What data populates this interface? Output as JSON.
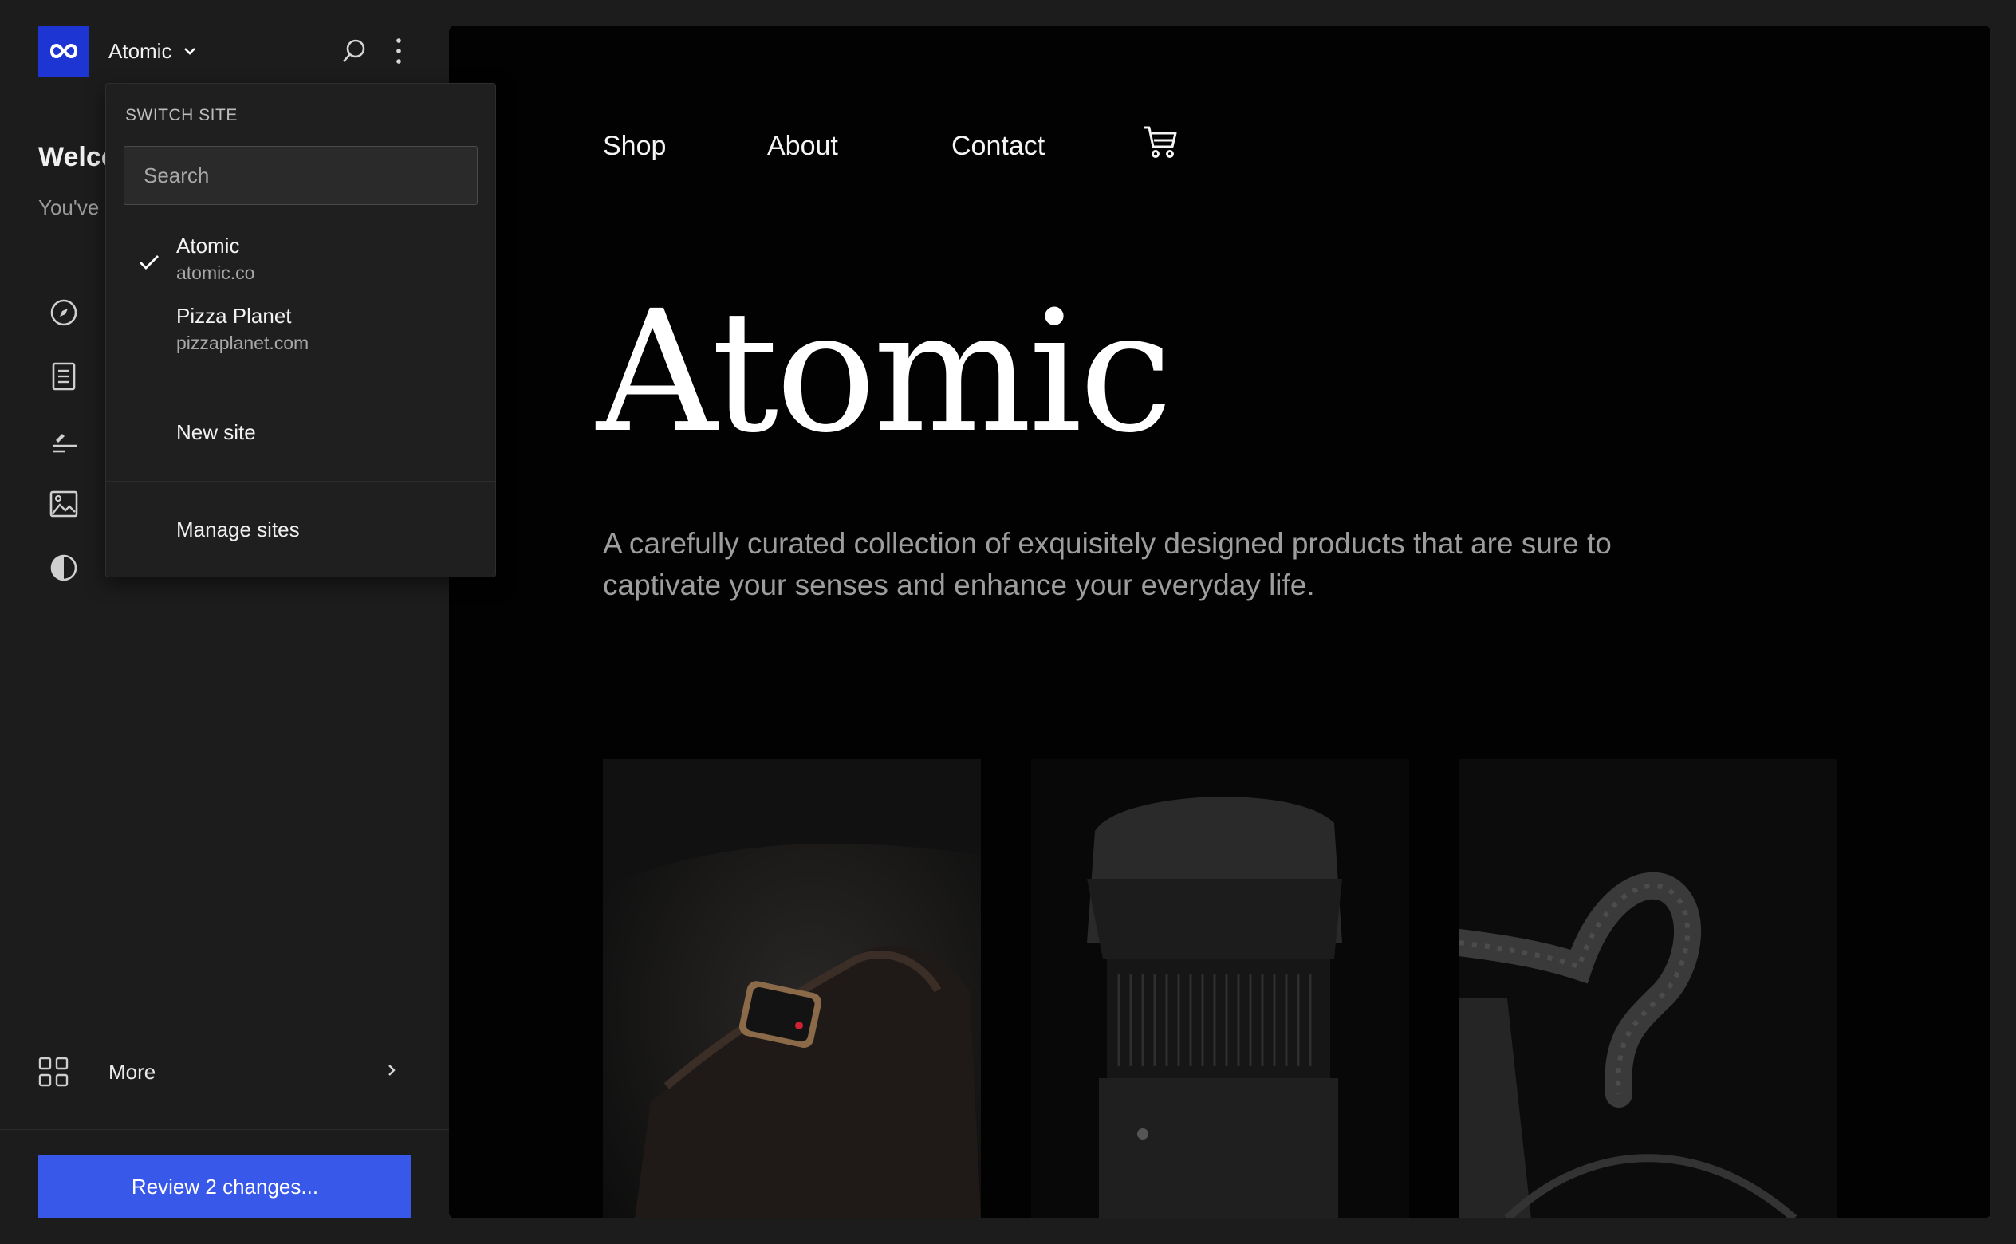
{
  "app": {
    "site_name": "Atomic",
    "welcome_title": "Welcome",
    "welcome_text": "You've ... your la",
    "more_label": "More",
    "review_button": "Review 2 changes...",
    "colors": {
      "accent": "#3858e9",
      "logo_bg": "#1d35d2",
      "sidebar_bg": "#1c1c1c",
      "preview_bg": "#020202"
    }
  },
  "topbar": {
    "logo_icon": "infinity-icon",
    "search_icon": "search-icon",
    "options_icon": "kebab-menu-icon"
  },
  "switch_site": {
    "heading": "Switch site",
    "search_placeholder": "Search",
    "sites": [
      {
        "name": "Atomic",
        "url": "atomic.co",
        "selected": true
      },
      {
        "name": "Pizza Planet",
        "url": "pizzaplanet.com",
        "selected": false
      }
    ],
    "new_site": "New site",
    "manage_sites": "Manage sites"
  },
  "sidebar_nav": [
    {
      "icon": "compass-icon"
    },
    {
      "icon": "pages-icon"
    },
    {
      "icon": "templates-icon"
    },
    {
      "icon": "media-icon"
    },
    {
      "icon": "styles-icon"
    }
  ],
  "preview": {
    "nav": [
      "Shop",
      "About",
      "Contact"
    ],
    "cart_icon": "cart-icon",
    "hero_title": "Atomic",
    "hero_desc": "A carefully curated collection of exquisitely designed products that are sure to captivate your senses and enhance your everyday life.",
    "products": [
      "smartwatch-photo",
      "camera-lens-photo",
      "bicycle-handlebar-photo"
    ]
  }
}
